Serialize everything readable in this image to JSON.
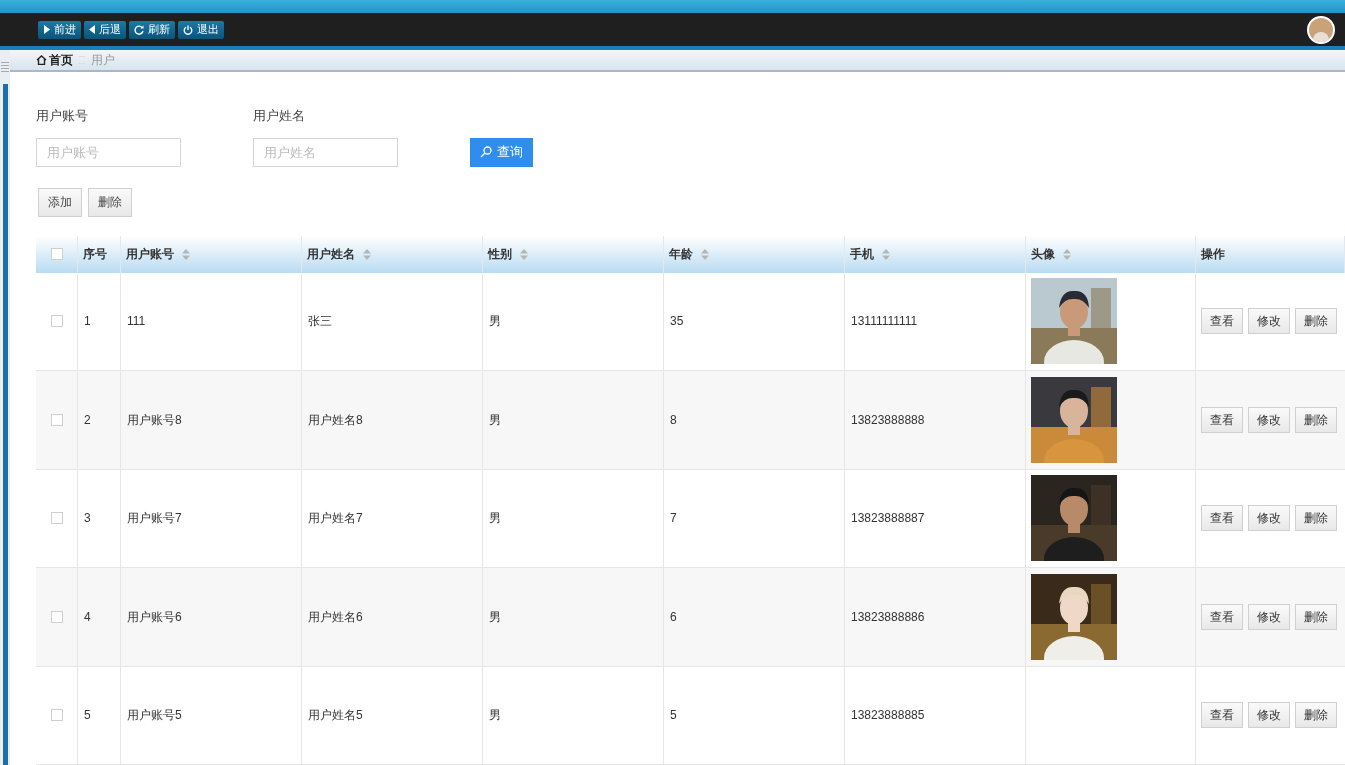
{
  "toolbar": {
    "buttons": [
      {
        "label": "前进",
        "kind": "forward"
      },
      {
        "label": "后退",
        "kind": "back"
      },
      {
        "label": "刷新",
        "kind": "refresh"
      },
      {
        "label": "退出",
        "kind": "exit"
      }
    ]
  },
  "breadcrumb": {
    "home": "首页",
    "current": "用户"
  },
  "search": {
    "fields": [
      {
        "label": "用户账号",
        "placeholder": "用户账号"
      },
      {
        "label": "用户姓名",
        "placeholder": "用户姓名"
      }
    ],
    "button": "查询"
  },
  "actions": [
    "添加",
    "删除"
  ],
  "table": {
    "select_all_checked": false,
    "columns": [
      {
        "label": "序号",
        "sortable": false
      },
      {
        "label": "用户账号",
        "sortable": true
      },
      {
        "label": "用户姓名",
        "sortable": true
      },
      {
        "label": "性别",
        "sortable": true
      },
      {
        "label": "年龄",
        "sortable": true
      },
      {
        "label": "手机",
        "sortable": true
      },
      {
        "label": "头像",
        "sortable": true
      },
      {
        "label": "操作",
        "sortable": false
      }
    ],
    "rows": [
      {
        "checked": false,
        "index": "1",
        "account": "111",
        "name": "张三",
        "gender": "男",
        "age": "35",
        "phone": "13111111111",
        "avatar": {
          "kind": "picture"
        },
        "buttons": [
          "查看",
          "修改",
          "删除"
        ]
      },
      {
        "checked": false,
        "index": "2",
        "account": "用户账号8",
        "name": "用户姓名8",
        "gender": "男",
        "age": "8",
        "phone": "13823888888",
        "avatar": {
          "kind": "picture"
        },
        "buttons": [
          "查看",
          "修改",
          "删除"
        ]
      },
      {
        "checked": false,
        "index": "3",
        "account": "用户账号7",
        "name": "用户姓名7",
        "gender": "男",
        "age": "7",
        "phone": "13823888887",
        "avatar": {
          "kind": "picture"
        },
        "buttons": [
          "查看",
          "修改",
          "删除"
        ]
      },
      {
        "checked": false,
        "index": "4",
        "account": "用户账号6",
        "name": "用户姓名6",
        "gender": "男",
        "age": "6",
        "phone": "13823888886",
        "avatar": {
          "kind": "picture"
        },
        "buttons": [
          "查看",
          "修改",
          "删除"
        ]
      },
      {
        "checked": false,
        "index": "5",
        "account": "用户账号5",
        "name": "用户姓名5",
        "gender": "男",
        "age": "5",
        "phone": "13823888885",
        "buttons": [
          "查看",
          "修改",
          "删除"
        ]
      }
    ]
  }
}
